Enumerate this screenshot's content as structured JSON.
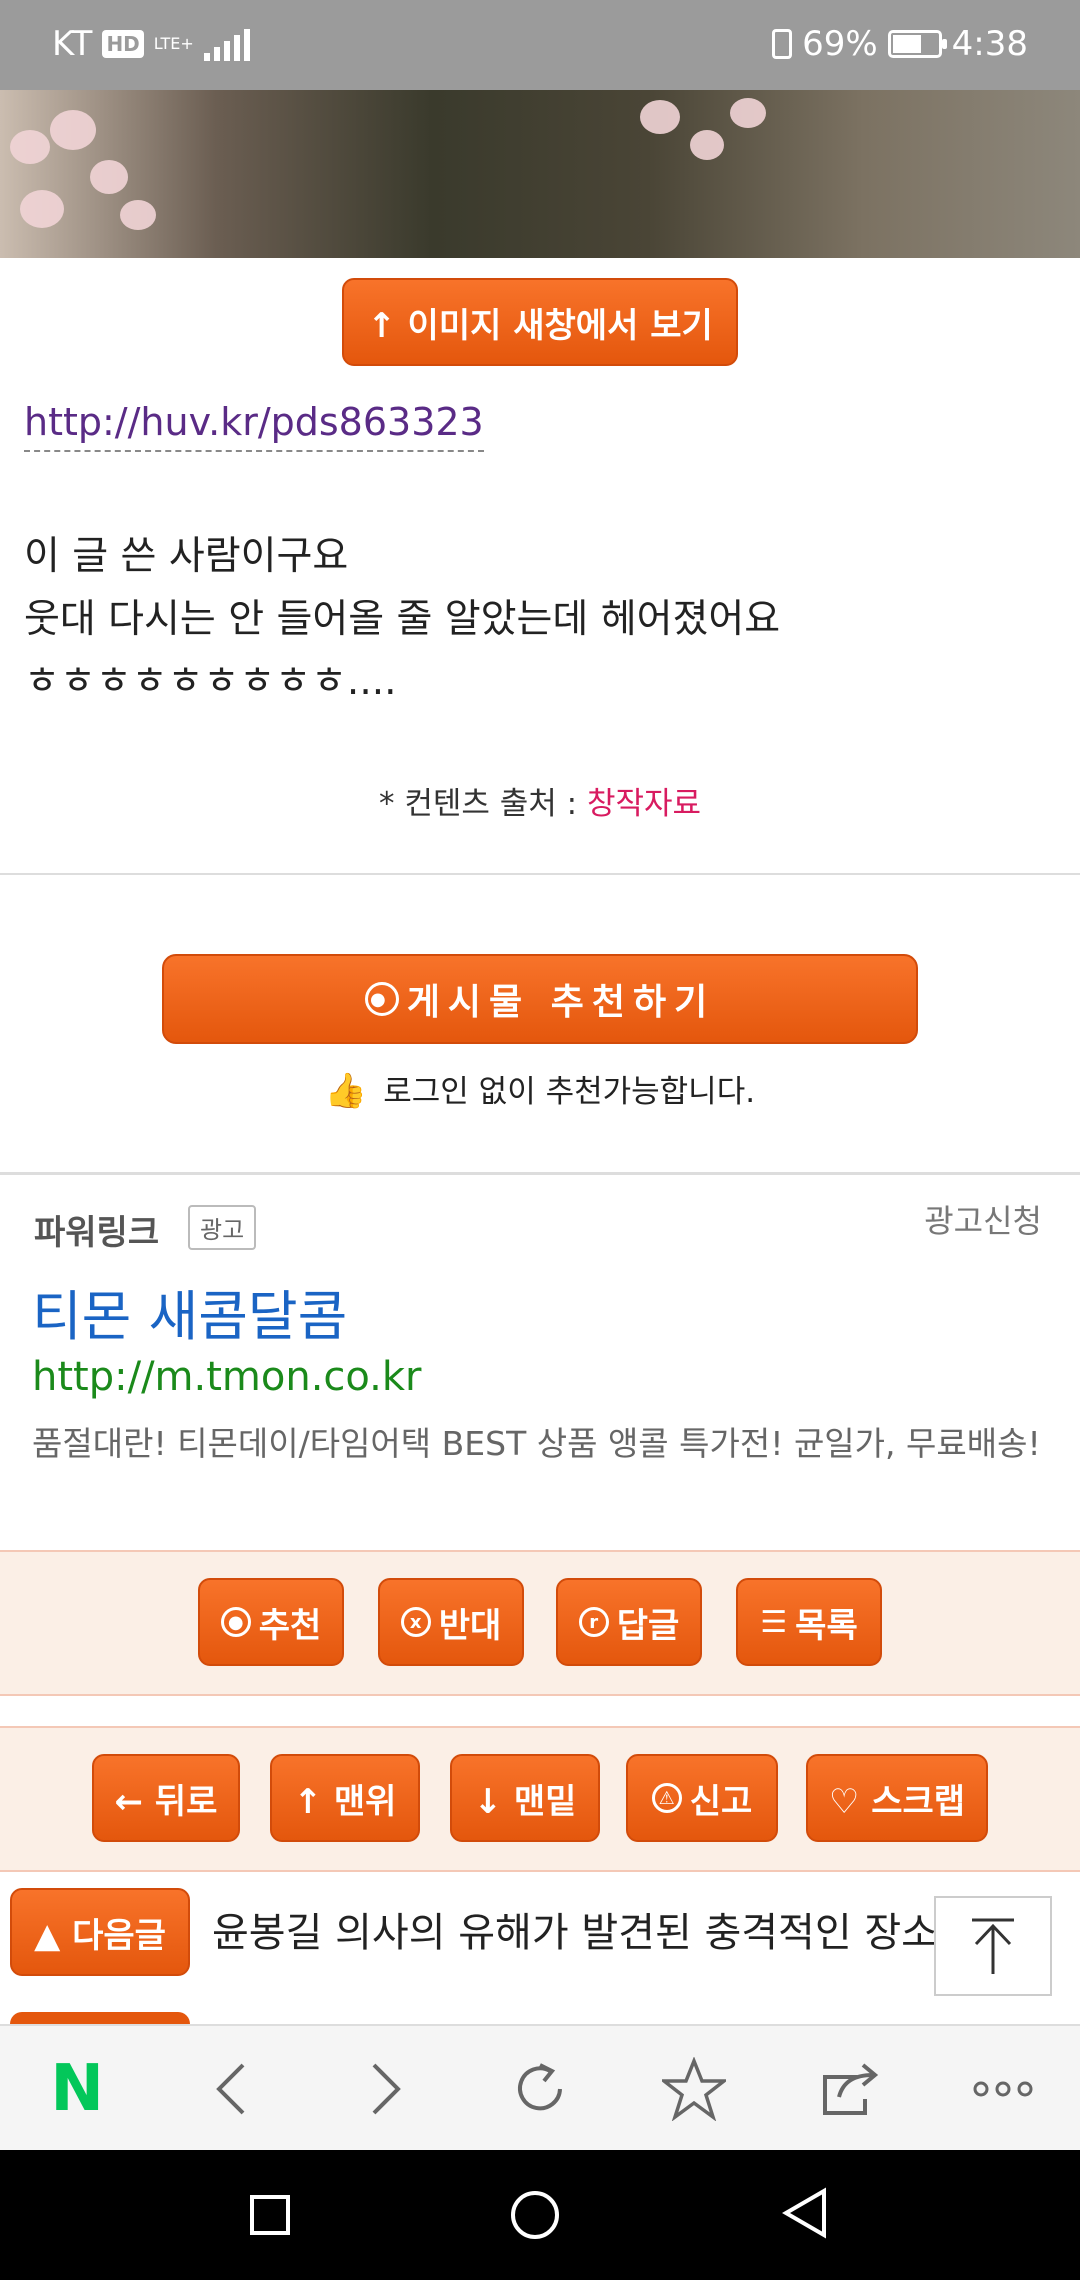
{
  "status": {
    "carrier": "KT",
    "hd": "HD",
    "net": "LTE+",
    "battery": "69%",
    "time": "4:38"
  },
  "image_button": "↑ 이미지 새창에서 보기",
  "link": "http://huv.kr/pds863323",
  "body_lines": [
    "이 글 쓴 사람이구요",
    "웃대 다시는 안 들어올 줄 알았는데 헤어졌어요",
    "ㅎㅎㅎㅎㅎㅎㅎㅎㅎ...."
  ],
  "source": {
    "prefix": "* 컨텐츠 출처 : ",
    "value": "창작자료"
  },
  "recommend": {
    "label": "게시물  추천하기",
    "note": "로그인 없이 추천가능합니다."
  },
  "ad": {
    "brand": "파워링크",
    "badge": "광고",
    "apply": "광고신청",
    "headline": "티몬 새콤달콤",
    "url": "http://m.tmon.co.kr",
    "desc": "품절대란! 티몬데이/타임어택 BEST 상품 앵콜 특가전! 균일가, 무료배송!"
  },
  "actions1": [
    {
      "label": "추천",
      "icon": "o"
    },
    {
      "label": "반대",
      "icon": "x"
    },
    {
      "label": "답글",
      "icon": "r"
    },
    {
      "label": "목록",
      "icon": "list"
    }
  ],
  "actions2": [
    {
      "label": "← 뒤로"
    },
    {
      "label": "↑ 맨위"
    },
    {
      "label": "↓ 맨밑"
    },
    {
      "label": "신고"
    },
    {
      "label": "♡ 스크랩"
    }
  ],
  "next": {
    "label": "▲ 다음글",
    "title": "윤봉길 의사의 유해가 발견된 충격적인 장소"
  },
  "toolbar_icons": [
    "naver-n-icon",
    "back-icon",
    "forward-icon",
    "refresh-icon",
    "star-icon",
    "share-icon",
    "more-icon"
  ],
  "naver_logo": "N"
}
